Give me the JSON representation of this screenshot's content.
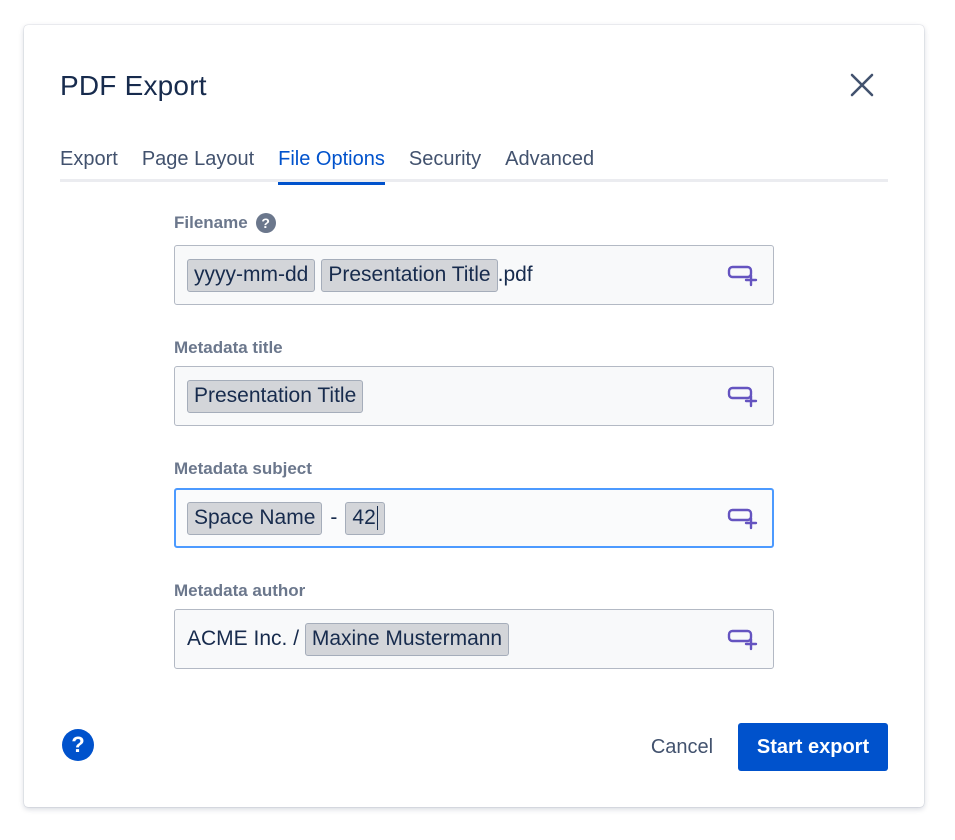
{
  "dialog": {
    "title": "PDF Export",
    "tabs": [
      {
        "label": "Export"
      },
      {
        "label": "Page Layout"
      },
      {
        "label": "File Options"
      },
      {
        "label": "Security"
      },
      {
        "label": "Advanced"
      }
    ],
    "active_tab": "File Options"
  },
  "fields": {
    "filename": {
      "label": "Filename",
      "help": "?",
      "chips": [
        "yyyy-mm-dd",
        "Presentation Title"
      ],
      "suffix": ".pdf"
    },
    "metadata_title": {
      "label": "Metadata title",
      "chips": [
        "Presentation Title"
      ]
    },
    "metadata_subject": {
      "label": "Metadata subject",
      "chips": [
        "Space Name",
        "42"
      ],
      "separator": "-"
    },
    "metadata_author": {
      "label": "Metadata author",
      "prefix": "ACME Inc. / ",
      "chips": [
        "Maxine Mustermann"
      ]
    }
  },
  "footer": {
    "help": "?",
    "cancel_label": "Cancel",
    "start_label": "Start export"
  },
  "colors": {
    "primary": "#0052cc",
    "focus_border": "#4c9aff",
    "insert_icon": "#6554c0"
  },
  "icons": {
    "close": "close-icon",
    "insert_variable": "insert-variable-icon",
    "help": "help-icon"
  }
}
